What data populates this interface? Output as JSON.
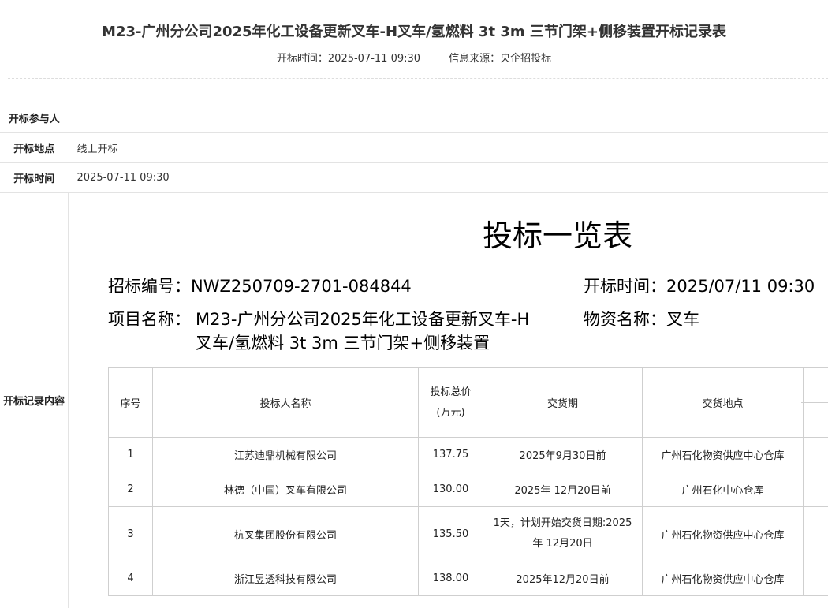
{
  "header": {
    "title": "M23-广州分公司2025年化工设备更新叉车-H叉车/氢燃料 3t 3m 三节门架+侧移装置开标记录表",
    "open_time_text": "开标时间：2025-07-11 09:30",
    "source_text": "信息来源：央企招投标"
  },
  "info": {
    "participants_label": "开标参与人",
    "participants_value": "",
    "location_label": "开标地点",
    "location_value": "线上开标",
    "time_label": "开标时间",
    "time_value": "2025-07-11 09:30",
    "content_label": "开标记录内容"
  },
  "document": {
    "title": "投标一览表",
    "bid_no": "招标编号：NWZ250709-2701-084844",
    "open_time": "开标时间：2025/07/11 09:30",
    "project_label": "项目名称：",
    "project_line1": "M23-广州分公司2025年化工设备更新叉车-H",
    "project_line2": "叉车/氢燃料 3t 3m 三节门架+侧移装置",
    "material": "物资名称：叉车"
  },
  "bid_table": {
    "headers": {
      "no": "序号",
      "bidder": "投标人名称",
      "price_line1": "投标总价",
      "price_line2": "(万元)",
      "delivery": "交货期",
      "place": "交货地点"
    },
    "rows": [
      {
        "no": "1",
        "bidder": "江苏迪鼎机械有限公司",
        "price": "137.75",
        "delivery": "2025年9月30日前",
        "delivery_line2": "",
        "place": "广州石化物资供应中心仓库"
      },
      {
        "no": "2",
        "bidder": "林德（中国）叉车有限公司",
        "price": "130.00",
        "delivery": "2025年 12月20日前",
        "delivery_line2": "",
        "place": "广州石化中心仓库"
      },
      {
        "no": "3",
        "bidder": "杭叉集团股份有限公司",
        "price": "135.50",
        "delivery": "1天，计划开始交货日期:2025",
        "delivery_line2": "年 12月20日",
        "place": "广州石化物资供应中心仓库"
      },
      {
        "no": "4",
        "bidder": "浙江昱透科技有限公司",
        "price": "138.00",
        "delivery": "2025年12月20日前",
        "delivery_line2": "",
        "place": "广州石化物资供应中心仓库"
      }
    ]
  }
}
